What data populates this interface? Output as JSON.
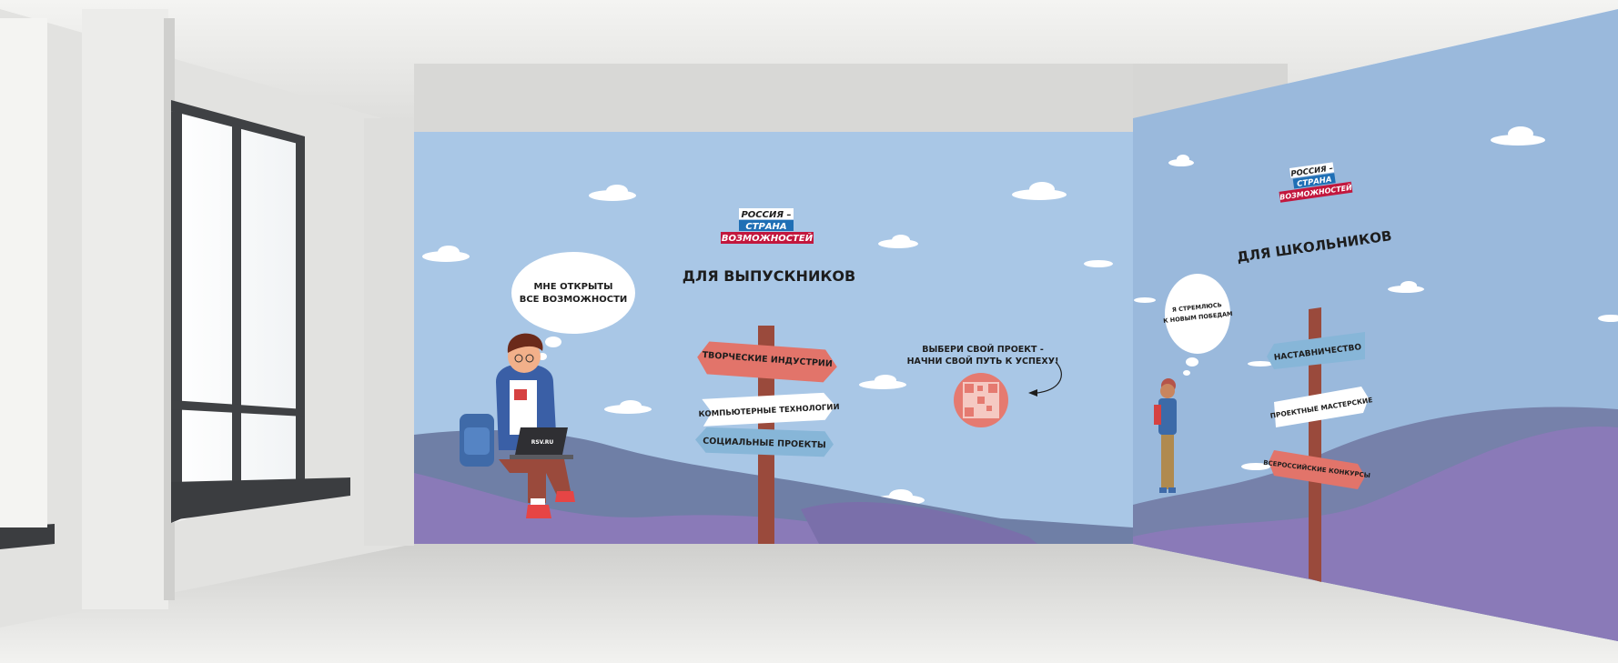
{
  "colors": {
    "wall_blue": "#a9c7e6",
    "side_wall_blue": "#9ab9dc",
    "hill_purple": "#8a7ab8",
    "hill_dark": "#6f7fa6",
    "post_brown": "#9a4a3c",
    "sign_red": "#e2746a",
    "sign_blue": "#87b6d8",
    "sign_white": "#ffffff",
    "logo_red": "#c2173d",
    "logo_blue": "#1f6fb5",
    "concrete": "#e4e4e2",
    "floor": "#dcdcda"
  },
  "main_wall": {
    "logo": {
      "line1": "РОССИЯ –",
      "line2": "СТРАНА",
      "line3": "ВОЗМОЖНОСТЕЙ"
    },
    "title": "ДЛЯ ВЫПУСКНИКОВ",
    "bubble": {
      "line1": "МНЕ ОТКРЫТЫ",
      "line2": "ВСЕ ВОЗМОЖНОСТИ"
    },
    "laptop_text": "RSV.RU",
    "signs": [
      "ТВОРЧЕСКИЕ ИНДУСТРИИ",
      "КОМПЬЮТЕРНЫЕ ТЕХНОЛОГИИ",
      "СОЦИАЛЬНЫЕ ПРОЕКТЫ"
    ],
    "cta": {
      "line1": "ВЫБЕРИ СВОЙ ПРОЕКТ -",
      "line2": "НАЧНИ СВОЙ ПУТЬ К УСПЕХУ!"
    }
  },
  "side_wall": {
    "logo": {
      "line1": "РОССИЯ –",
      "line2": "СТРАНА",
      "line3": "ВОЗМОЖНОСТЕЙ"
    },
    "title": "ДЛЯ ШКОЛЬНИКОВ",
    "bubble": {
      "line1": "Я СТРЕМЛЮСЬ",
      "line2": "К НОВЫМ ПОБЕДАМ"
    },
    "signs": [
      "НАСТАВНИЧЕСТВО",
      "ПРОЕКТНЫЕ МАСТЕРСКИЕ",
      "ВСЕРОССИЙСКИЕ КОНКУРСЫ"
    ]
  }
}
